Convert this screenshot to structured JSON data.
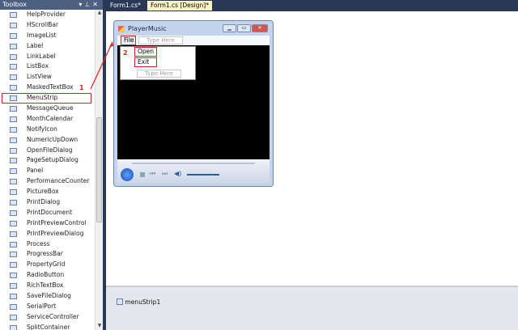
{
  "toolbox": {
    "title": "Toolbox",
    "items": [
      "HelpProvider",
      "HScrollBar",
      "ImageList",
      "Label",
      "LinkLabel",
      "ListBox",
      "ListView",
      "MaskedTextBox",
      "MenuStrip",
      "MessageQueue",
      "MonthCalendar",
      "NotifyIcon",
      "NumericUpDown",
      "OpenFileDialog",
      "PageSetupDialog",
      "Panel",
      "PerformanceCounter",
      "PictureBox",
      "PrintDialog",
      "PrintDocument",
      "PrintPreviewControl",
      "PrintPreviewDialog",
      "Process",
      "ProgressBar",
      "PropertyGrid",
      "RadioButton",
      "RichTextBox",
      "SaveFileDialog",
      "SerialPort",
      "ServiceController",
      "SplitContainer"
    ],
    "selected": "MenuStrip"
  },
  "tabs": [
    {
      "label": "Form1.cs*"
    },
    {
      "label": "Form1.cs [Design]*",
      "active": true
    }
  ],
  "form": {
    "title": "PlayerMusic",
    "menu": {
      "file": "File",
      "type_here": "Type Here",
      "items": [
        "Open",
        "Exit"
      ],
      "dropdown_type_here": "Type Here"
    }
  },
  "annotations": {
    "step1": "1",
    "step2": "2"
  },
  "tray": {
    "component": "menuStrip1"
  },
  "colors": {
    "highlight": "#e02020",
    "chrome": "#293955"
  }
}
